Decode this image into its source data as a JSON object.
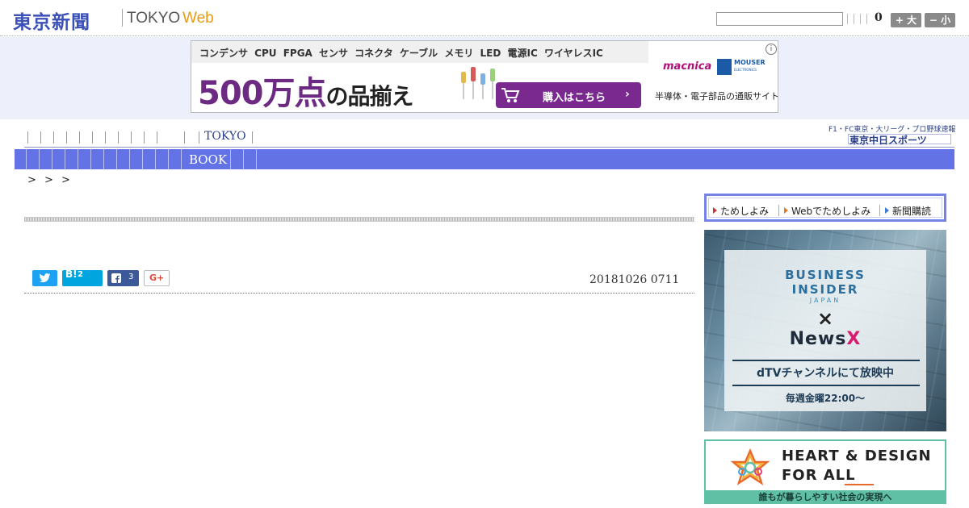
{
  "header": {
    "logo_jp": "東京新聞",
    "logo_tokyo": "TOKYO",
    "logo_web": "Web",
    "search_value": "",
    "count": "0",
    "font_large": "+ 大",
    "font_small": "− 小"
  },
  "ad": {
    "categories": "コンデンサ CPU FPGA センサ コネクタ ケーブル メモリ LED 電源IC ワイヤレスIC",
    "big_text": "500万点",
    "big_text_tail": "の品揃え",
    "buy_button": "購入はこちら",
    "arrow": "›",
    "macnica": "macnica",
    "mouser": "MOUSER",
    "mouser_sub": "ELECTRONICS",
    "tagline": "半導体・電子部品の通販サイト",
    "info": "i"
  },
  "nav": {
    "tokyo": "TOKYO",
    "book": "BOOK",
    "sports_line": "F1・FC東京・大リーグ・プロ野球速報",
    "sports_logo": "東京中日スポーツ"
  },
  "breadcrumb": "> > >",
  "share": {
    "twitter_count": "",
    "hatena_label": "B!",
    "hatena_count": "2",
    "facebook_count": "3",
    "gplus_label": "G+"
  },
  "article": {
    "dateline": "20181026 0711"
  },
  "sidebar": {
    "tame_links": [
      "ためしよみ",
      "Webでためしよみ",
      "新聞購読"
    ],
    "bi": {
      "line1": "BUSINESS",
      "line2": "INSIDER",
      "line3": "JAPAN",
      "cross": "×",
      "news": "News",
      "news_x": "X",
      "dtv": "dTVチャンネルにて放映中",
      "time": "毎週金曜22:00〜"
    },
    "hd": {
      "line1": "HEART & DESIGN",
      "line2": "FOR ALL",
      "band": "誰もが暮らしやすい社会の実現へ"
    }
  },
  "colors": {
    "brand_blue": "#3a4fb7",
    "nav_blue": "#6373e6",
    "web_orange": "#e89a12",
    "ad_purple": "#7a2a8e",
    "hd_green": "#5fc0a6"
  }
}
